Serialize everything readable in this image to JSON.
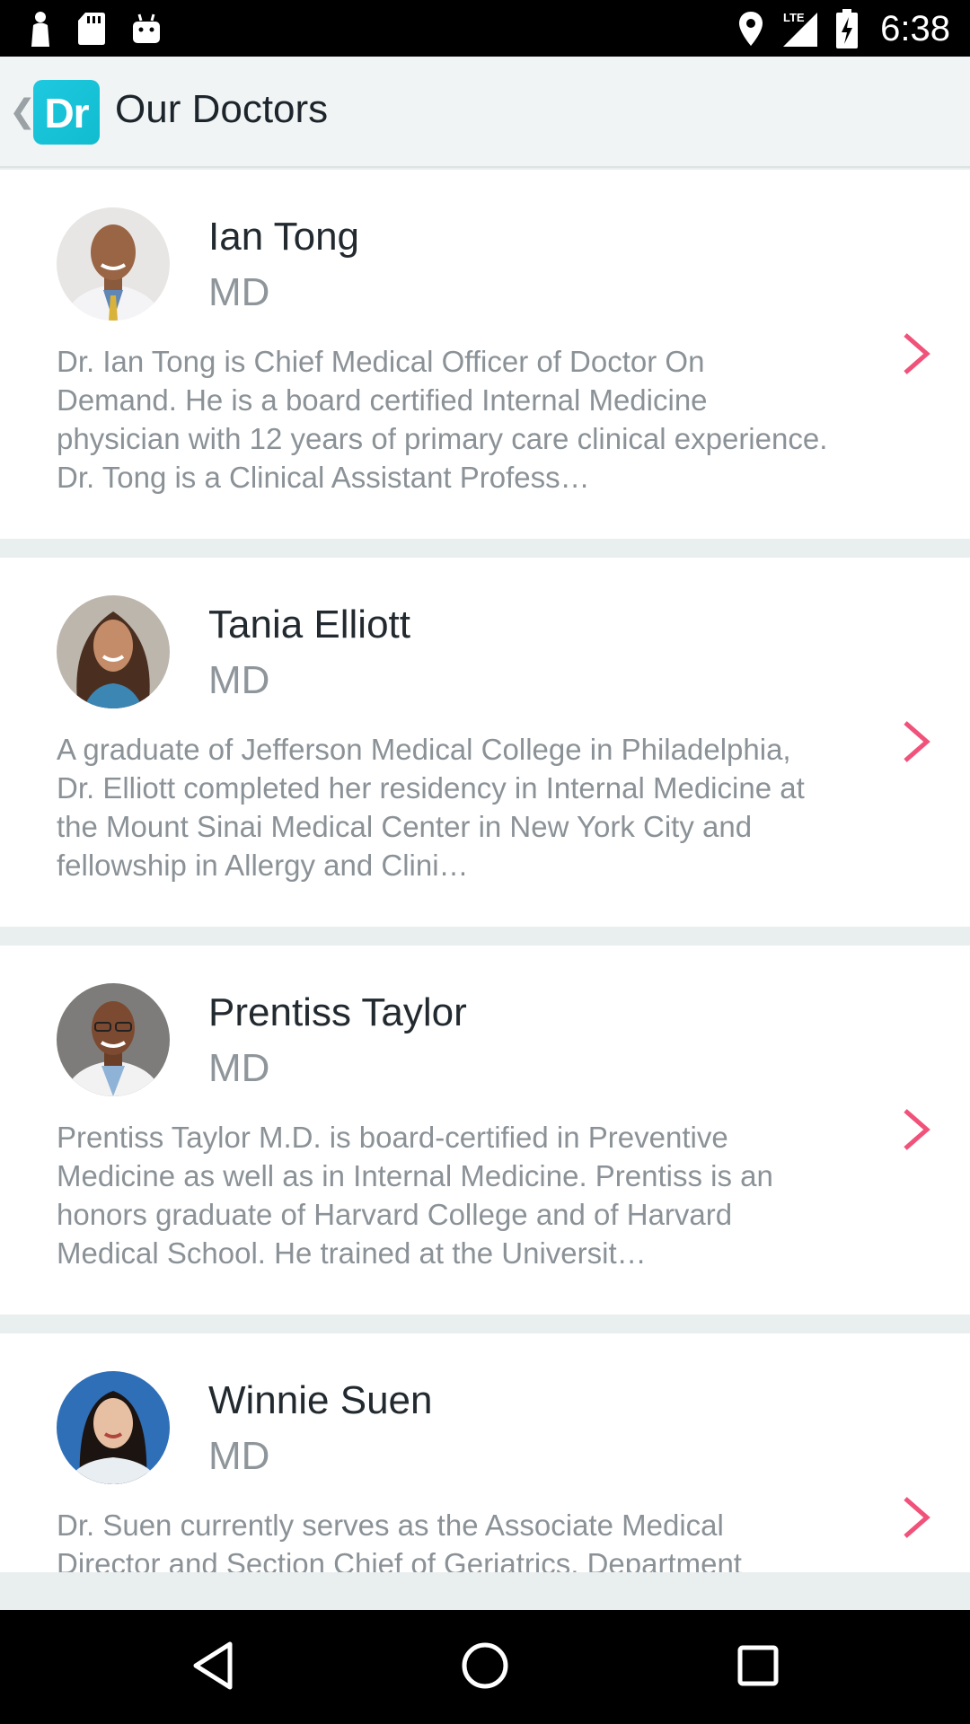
{
  "status_bar": {
    "time": "6:38",
    "network": "LTE",
    "left_icons": [
      "person-icon",
      "sd-card-icon",
      "android-icon"
    ],
    "right_icons": [
      "location-icon",
      "signal-icon",
      "battery-charging-icon"
    ]
  },
  "app_bar": {
    "logo_text": "Dr",
    "title": "Our Doctors",
    "accent": "#16c3d8"
  },
  "doctors": [
    {
      "name": "Ian Tong",
      "credential": "MD",
      "bio": "Dr. Ian Tong is Chief Medical Officer of Doctor On Demand. He is a board certified Internal Medicine physician with 12 years of primary care clinical experience. Dr. Tong is a Clinical Assistant Profess…"
    },
    {
      "name": "Tania Elliott",
      "credential": "MD",
      "bio": "A graduate of Jefferson Medical College in Philadelphia, Dr. Elliott completed her residency in Internal Medicine at the Mount Sinai Medical Center in New York City and fellowship in Allergy and Clini…"
    },
    {
      "name": "Prentiss Taylor",
      "credential": "MD",
      "bio": "Prentiss Taylor M.D. is board-certified in Preventive Medicine as well as in Internal Medicine. Prentiss is an honors graduate of Harvard College and of Harvard Medical School. He trained at the Universit…"
    },
    {
      "name": "Winnie Suen",
      "credential": "MD",
      "bio": "Dr. Suen currently serves as the Associate Medical Director and Section Chief of Geriatrics, Department"
    }
  ],
  "chevron_color": "#f0527a",
  "nav_bar": {
    "buttons": [
      "back-icon",
      "home-icon",
      "recents-icon"
    ]
  }
}
